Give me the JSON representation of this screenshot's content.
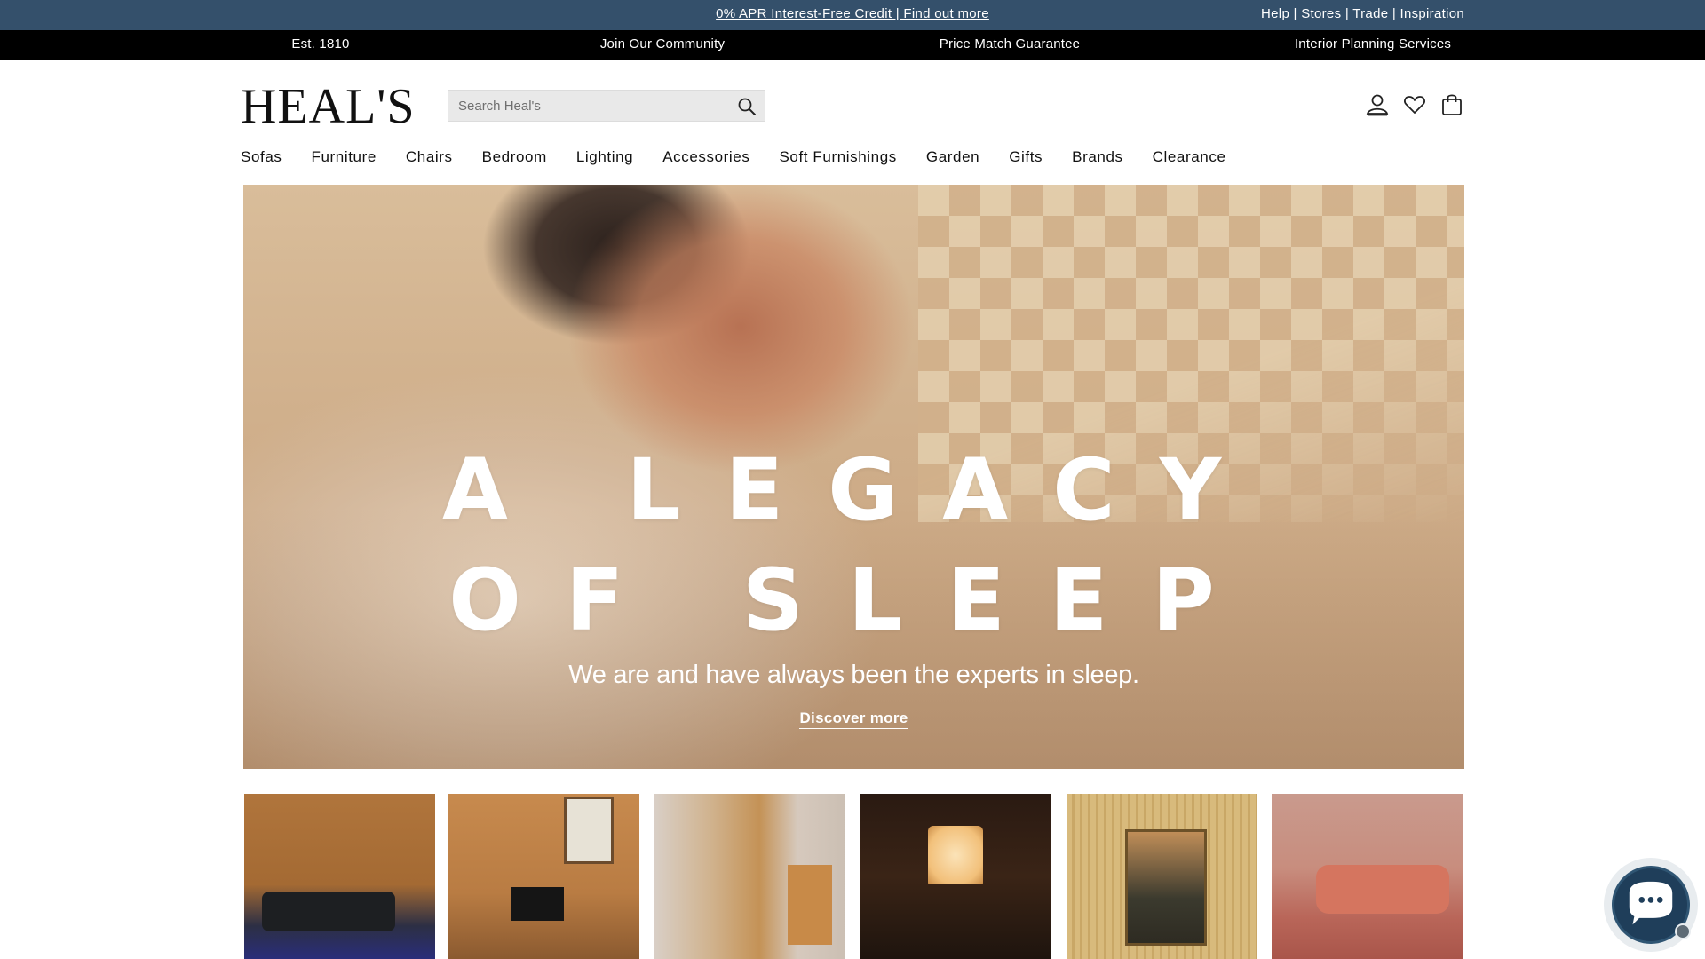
{
  "promo": {
    "center_link": "0% APR Interest-Free Credit | Find out more",
    "right_links": "Help | Stores | Trade | Inspiration"
  },
  "usp": {
    "items": [
      "Est. 1810",
      "Join Our Community",
      "Price Match Guarantee",
      "Interior Planning Services"
    ]
  },
  "header": {
    "logo": "HEAL'S",
    "search_placeholder": "Search Heal's",
    "icons": [
      "account-icon",
      "wishlist-heart-icon",
      "basket-bag-icon",
      "search-icon"
    ]
  },
  "nav": {
    "items": [
      "Sofas",
      "Furniture",
      "Chairs",
      "Bedroom",
      "Lighting",
      "Accessories",
      "Soft Furnishings",
      "Garden",
      "Gifts",
      "Brands",
      "Clearance"
    ]
  },
  "hero": {
    "title_line1": "A LEGACY",
    "title_line2": "OF SLEEP",
    "subtitle": "We are and have always been the experts in sleep.",
    "cta": "Discover more"
  },
  "colors": {
    "promo_bar": "#34506b",
    "usp_bar": "#000000",
    "search_bg": "#e9e9e9",
    "chat_bubble": "#1f3e5a"
  }
}
